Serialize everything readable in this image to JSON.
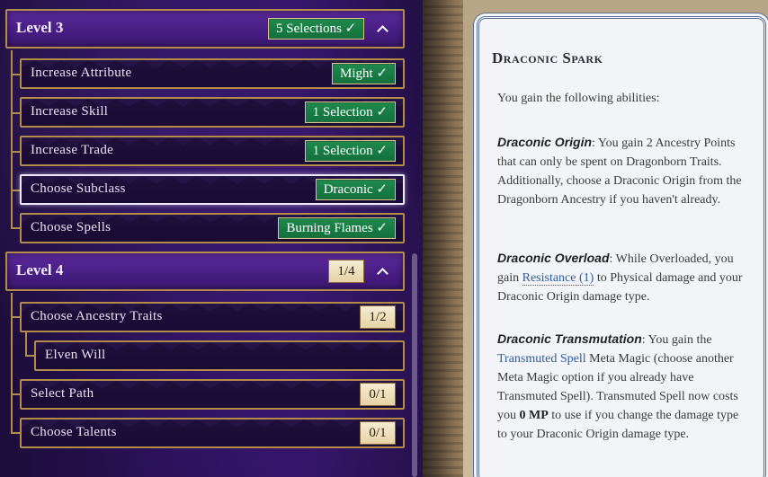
{
  "level3": {
    "title": "Level 3",
    "badge": "5 Selections ✓",
    "rows": [
      {
        "label": "Increase Attribute",
        "badge": "Might ✓"
      },
      {
        "label": "Increase Skill",
        "badge": "1 Selection ✓"
      },
      {
        "label": "Increase Trade",
        "badge": "1 Selection ✓"
      },
      {
        "label": "Choose Subclass",
        "badge": "Draconic ✓"
      },
      {
        "label": "Choose Spells",
        "badge": "Burning Flames ✓"
      }
    ]
  },
  "level4": {
    "title": "Level 4",
    "badge": "1/4",
    "rows": [
      {
        "label": "Choose Ancestry Traits",
        "badge": "1/2"
      },
      {
        "label": "Elven Will"
      },
      {
        "label": "Select Path",
        "badge": "0/1"
      },
      {
        "label": "Choose Talents",
        "badge": "0/1"
      }
    ]
  },
  "detail": {
    "title": "Draconic Spark",
    "intro": "You gain the following abilities:",
    "origin_name": "Draconic Origin",
    "origin_text": ": You gain 2 Ancestry Points that can only be spent on Dragonborn Traits. Additionally, choose a Draconic Origin from the Dragonborn Ancestry if you haven't already.",
    "overload_name": "Draconic Overload",
    "overload_text_a": ": While Overloaded, you gain ",
    "overload_link": "Resistance (1)",
    "overload_text_b": " to Physical damage and your Draconic Origin damage type.",
    "trans_name": "Draconic Transmutation",
    "trans_text_a": ": You gain the ",
    "trans_link": "Transmuted Spell",
    "trans_text_b": " Meta Magic (choose another Meta Magic option if you already have Transmuted Spell). Transmuted Spell now costs you ",
    "trans_bold": "0 MP",
    "trans_text_c": " to use if you change the damage type to your Draconic Origin damage type."
  },
  "colors": {
    "accent_green": "#13703c",
    "panel_purple": "#4a1f86",
    "border_gold": "#b48c4a",
    "link_blue": "#2e5da0"
  }
}
